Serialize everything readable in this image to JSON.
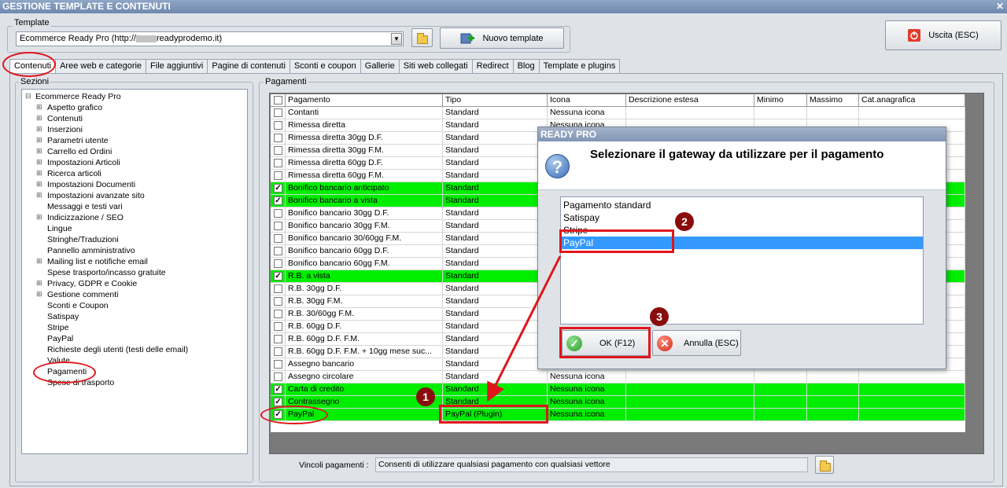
{
  "window": {
    "title": "GESTIONE TEMPLATE E CONTENUTI",
    "close": "✕"
  },
  "template_group": {
    "label": "Template",
    "combo_prefix": "Ecommerce Ready Pro (http://",
    "combo_suffix": "readyprodemo.it)",
    "new_template_label": "Nuovo template"
  },
  "exit_label": "Uscita (ESC)",
  "tabs": [
    "Contenuti",
    "Aree web e categorie",
    "File aggiuntivi",
    "Pagine di contenuti",
    "Sconti e coupon",
    "Gallerie",
    "Siti web collegati",
    "Redirect",
    "Blog",
    "Template e plugins"
  ],
  "sections": {
    "label": "Sezioni",
    "root": "Ecommerce Ready Pro",
    "items": [
      {
        "label": "Aspetto grafico",
        "expandable": true
      },
      {
        "label": "Contenuti",
        "expandable": true
      },
      {
        "label": "Inserzioni",
        "expandable": true
      },
      {
        "label": "Parametri utente",
        "expandable": true
      },
      {
        "label": "Carrello ed Ordini",
        "expandable": true
      },
      {
        "label": "Impostazioni Articoli",
        "expandable": true
      },
      {
        "label": "Ricerca articoli",
        "expandable": true
      },
      {
        "label": "Impostazioni Documenti",
        "expandable": true
      },
      {
        "label": "Impostazioni avanzate sito",
        "expandable": true
      },
      {
        "label": "Messaggi e testi vari",
        "expandable": false
      },
      {
        "label": "Indicizzazione / SEO",
        "expandable": true
      },
      {
        "label": "Lingue",
        "expandable": false
      },
      {
        "label": "Stringhe/Traduzioni",
        "expandable": false
      },
      {
        "label": "Pannello amministrativo",
        "expandable": false
      },
      {
        "label": "Mailing list e notifiche email",
        "expandable": true
      },
      {
        "label": "Spese trasporto/incasso gratuite",
        "expandable": false
      },
      {
        "label": "Privacy, GDPR e Cookie",
        "expandable": true
      },
      {
        "label": "Gestione commenti",
        "expandable": true
      },
      {
        "label": "Sconti e Coupon",
        "expandable": false
      },
      {
        "label": "Satispay",
        "expandable": false
      },
      {
        "label": "Stripe",
        "expandable": false
      },
      {
        "label": "PayPal",
        "expandable": false
      },
      {
        "label": "Richieste degli utenti (testi delle email)",
        "expandable": false
      },
      {
        "label": "Valute",
        "expandable": false
      },
      {
        "label": "Pagamenti",
        "expandable": false
      },
      {
        "label": "Spese di trasporto",
        "expandable": false
      }
    ]
  },
  "payments": {
    "label": "Pagamenti",
    "columns": [
      "Pagamento",
      "Tipo",
      "Icona",
      "Descrizione estesa",
      "Minimo",
      "Massimo",
      "Cat.anagrafica"
    ],
    "rows": [
      {
        "name": "Contanti",
        "tipo": "Standard",
        "icona": "Nessuna icona",
        "checked": false,
        "green": false
      },
      {
        "name": "Rimessa diretta",
        "tipo": "Standard",
        "icona": "Nessuna icona",
        "checked": false,
        "green": false
      },
      {
        "name": "Rimessa diretta 30gg D.F.",
        "tipo": "Standard",
        "icona": "",
        "checked": false,
        "green": false
      },
      {
        "name": "Rimessa diretta 30gg F.M.",
        "tipo": "Standard",
        "icona": "",
        "checked": false,
        "green": false
      },
      {
        "name": "Rimessa diretta 60gg D.F.",
        "tipo": "Standard",
        "icona": "",
        "checked": false,
        "green": false
      },
      {
        "name": "Rimessa diretta 60gg F.M.",
        "tipo": "Standard",
        "icona": "",
        "checked": false,
        "green": false
      },
      {
        "name": "Bonifico bancario anticipato",
        "tipo": "Standard",
        "icona": "",
        "checked": true,
        "green": true
      },
      {
        "name": "Bonifico bancario a vista",
        "tipo": "Standard",
        "icona": "",
        "checked": true,
        "green": true
      },
      {
        "name": "Bonifico bancario 30gg D.F.",
        "tipo": "Standard",
        "icona": "",
        "checked": false,
        "green": false
      },
      {
        "name": "Bonifico bancario 30gg F.M.",
        "tipo": "Standard",
        "icona": "",
        "checked": false,
        "green": false
      },
      {
        "name": "Bonifico bancario 30/60gg F.M.",
        "tipo": "Standard",
        "icona": "",
        "checked": false,
        "green": false
      },
      {
        "name": "Bonifico bancario 60gg D.F.",
        "tipo": "Standard",
        "icona": "",
        "checked": false,
        "green": false
      },
      {
        "name": "Bonifico bancario 60gg F.M.",
        "tipo": "Standard",
        "icona": "",
        "checked": false,
        "green": false
      },
      {
        "name": "R.B. a vista",
        "tipo": "Standard",
        "icona": "",
        "checked": true,
        "green": true
      },
      {
        "name": "R.B. 30gg D.F.",
        "tipo": "Standard",
        "icona": "",
        "checked": false,
        "green": false
      },
      {
        "name": "R.B. 30gg F.M.",
        "tipo": "Standard",
        "icona": "",
        "checked": false,
        "green": false
      },
      {
        "name": "R.B. 30/60gg F.M.",
        "tipo": "Standard",
        "icona": "",
        "checked": false,
        "green": false
      },
      {
        "name": "R.B. 60gg D.F.",
        "tipo": "Standard",
        "icona": "",
        "checked": false,
        "green": false
      },
      {
        "name": "R.B. 60gg D.F. F.M.",
        "tipo": "Standard",
        "icona": "",
        "checked": false,
        "green": false
      },
      {
        "name": "R.B. 60gg D.F. F.M. + 10gg mese suc...",
        "tipo": "Standard",
        "icona": "",
        "checked": false,
        "green": false
      },
      {
        "name": "Assegno bancario",
        "tipo": "Standard",
        "icona": "",
        "checked": false,
        "green": false
      },
      {
        "name": "Assegno circolare",
        "tipo": "Standard",
        "icona": "Nessuna icona",
        "checked": false,
        "green": false
      },
      {
        "name": "Carta di credito",
        "tipo": "Standard",
        "icona": "Nessuna icona",
        "checked": true,
        "green": true
      },
      {
        "name": "Contrassegno",
        "tipo": "Standard",
        "icona": "Nessuna icona",
        "checked": true,
        "green": true
      },
      {
        "name": "PayPal",
        "tipo": "PayPal (Plugin)",
        "icona": "Nessuna icona",
        "checked": true,
        "green": true
      }
    ]
  },
  "constraints": {
    "label": "Vincoli pagamenti :",
    "value": "Consenti di utilizzare qualsiasi pagamento con qualsiasi vettore"
  },
  "dialog": {
    "title": "READY PRO",
    "message": "Selezionare il gateway da utilizzare per il pagamento",
    "options": [
      "Pagamento standard",
      "Satispay",
      "Stripe",
      "PayPal"
    ],
    "selected": "PayPal",
    "ok_label": "OK (F12)",
    "cancel_label": "Annulla (ESC)"
  },
  "annotations": {
    "badge1": "1",
    "badge2": "2",
    "badge3": "3"
  },
  "colors": {
    "highlight_red": "#e0161c",
    "row_green": "#00ee00",
    "badge": "#8a0d0d",
    "selection": "#3399ff"
  }
}
